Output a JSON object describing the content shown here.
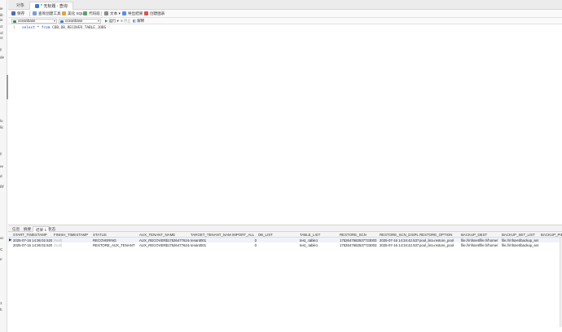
{
  "left_fragments": [
    "ie",
    "ib",
    "ie",
    "ct",
    "ol",
    "ct",
    "y",
    "de",
    "lo",
    "lic",
    "y",
    "re",
    "d",
    "gy",
    "vc",
    "C",
    "e",
    "1",
    "h"
  ],
  "tabs": [
    {
      "label": "对象",
      "active": false
    },
    {
      "label": "* 无标题 - 查询",
      "active": true
    }
  ],
  "toolbar": {
    "save": "保存",
    "query_builder": "查询创建工具",
    "beautify": "美化 SQL",
    "snippet": "代码段",
    "text": "文本",
    "export": "导出结果",
    "chart": "创建图表"
  },
  "connection": {
    "conn": "oceanbase",
    "db": "oceanbase",
    "run": "运行",
    "stop": "停止",
    "explain": "解释"
  },
  "editor": {
    "line_number": "1",
    "keyword_select": "select",
    "star": "*",
    "keyword_from": "from",
    "table": "CDB_OB_RECOVER_TABLE_JOBS"
  },
  "result_tabs": [
    "信息",
    "摘要",
    "结果 1",
    "状态"
  ],
  "result_active_index": 2,
  "columns": [
    "START_TIMESTAMP",
    "FINISH_TIMESTAMP",
    "STATUS",
    "AUX_TENANT_NAME",
    "TARGET_TENANT_NAME",
    "IMPORT_ALL",
    "DB_LIST",
    "TABLE_LIST",
    "RESTORE_SCN",
    "RESTORE_SCN_DISPLAY",
    "RESTORE_OPTION",
    "BACKUP_DEST",
    "BACKUP_SET_LIST",
    "BACKUP_PIE"
  ],
  "rows": [
    {
      "marker": "▶",
      "cells": [
        "2025-07-16 14:36:02.520",
        "(Null)",
        "RECOVERING",
        "AUX_RECOVER$1752647762441",
        "tenant001",
        "0",
        "",
        "test_.table1",
        "1752647682537723003",
        "2025-07-16 14:34:42.537",
        "pool_list=restore_pool",
        "file:///nfsnet/file:///home/",
        "file:///nfsnet/backup_set file:///home",
        ""
      ]
    },
    {
      "marker": "",
      "cells": [
        "2025-07-16 14:36:02.520",
        "(Null)",
        "RESTORE_AUX_TENANT",
        "AUX_RECOVER$1752647762441",
        "tenant001",
        "0",
        "",
        "test_.table1",
        "1752647682537723003",
        "2025-07-16 14:34:42.537",
        "pool_list=restore_pool",
        "file:///nfsnet/file:///home/",
        "file:///nfsnet/backup_set file:///home",
        ""
      ]
    }
  ],
  "colors": {
    "accent": "#3a7bd5",
    "keyword": "#1f3fbf",
    "selected_row": "#eef3fb"
  }
}
